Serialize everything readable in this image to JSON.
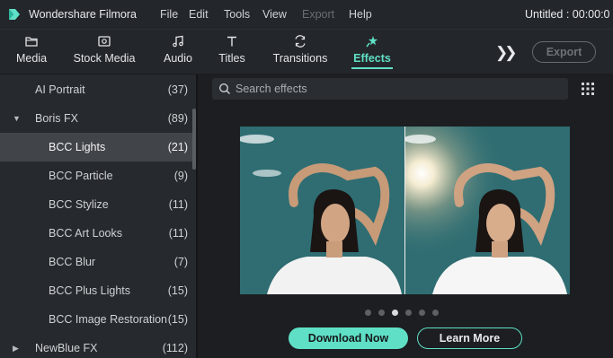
{
  "app": {
    "title": "Wondershare Filmora",
    "document_title": "Untitled : 00:00:0",
    "accent_color": "#5fe0c6"
  },
  "menu": {
    "items": [
      {
        "label": "File",
        "enabled": true
      },
      {
        "label": "Edit",
        "enabled": true
      },
      {
        "label": "Tools",
        "enabled": true
      },
      {
        "label": "View",
        "enabled": true
      },
      {
        "label": "Export",
        "enabled": false
      },
      {
        "label": "Help",
        "enabled": true
      }
    ]
  },
  "toolbar": {
    "tabs": [
      {
        "label": "Media",
        "icon": "folder-icon"
      },
      {
        "label": "Stock Media",
        "icon": "stock-media-icon"
      },
      {
        "label": "Audio",
        "icon": "music-note-icon"
      },
      {
        "label": "Titles",
        "icon": "text-t-icon"
      },
      {
        "label": "Transitions",
        "icon": "transitions-icon"
      },
      {
        "label": "Effects",
        "icon": "effects-sparkle-icon",
        "active": true
      }
    ],
    "more_icon": "double-chevron-right-icon",
    "export_label": "Export"
  },
  "sidebar": {
    "categories": [
      {
        "label": "AI Portrait",
        "count": "(37)",
        "level": 0,
        "arrow": ""
      },
      {
        "label": "Boris FX",
        "count": "(89)",
        "level": 0,
        "arrow": "expanded"
      },
      {
        "label": "BCC Lights",
        "count": "(21)",
        "level": 1,
        "selected": true
      },
      {
        "label": "BCC Particle",
        "count": "(9)",
        "level": 1
      },
      {
        "label": "BCC Stylize",
        "count": "(11)",
        "level": 1
      },
      {
        "label": "BCC Art Looks",
        "count": "(11)",
        "level": 1
      },
      {
        "label": "BCC Blur",
        "count": "(7)",
        "level": 1
      },
      {
        "label": "BCC Plus Lights",
        "count": "(15)",
        "level": 1
      },
      {
        "label": "BCC Image Restoration",
        "count": "(15)",
        "level": 1
      },
      {
        "label": "NewBlue FX",
        "count": "(112)",
        "level": 0,
        "arrow": "collapsed"
      }
    ]
  },
  "search": {
    "placeholder": "Search effects",
    "value": ""
  },
  "preview": {
    "slide_count": 6,
    "active_slide": 2
  },
  "actions": {
    "download_label": "Download Now",
    "learn_more_label": "Learn More"
  }
}
